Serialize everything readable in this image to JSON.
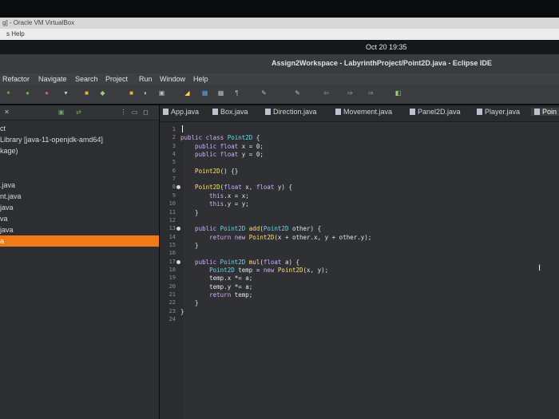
{
  "vbox": {
    "title": "g] - Oracle VM VirtualBox",
    "menu_help": "s    Help"
  },
  "topbar": {
    "clock": "Oct 20  19:35"
  },
  "window": {
    "title": "Assign2Workspace - LabyrinthProject/Point2D.java - Eclipse IDE"
  },
  "menubar": {
    "items": [
      "Refactor",
      "Navigate",
      "Search",
      "Project",
      "Run",
      "Window",
      "Help"
    ]
  },
  "explorer": {
    "items": [
      "ct",
      "Library [java-11-openjdk-amd64]",
      "kage)",
      ".java",
      "nt.java",
      "java",
      "va",
      "java",
      "a"
    ],
    "selected_index": 8
  },
  "tabs": [
    "App.java",
    "Box.java",
    "Direction.java",
    "Movement.java",
    "Panel2D.java",
    "Player.java",
    "Poin"
  ],
  "editor": {
    "lines": [
      {
        "n": "1",
        "fold": false,
        "tokens": []
      },
      {
        "n": "2",
        "fold": false,
        "tokens": [
          [
            "kw",
            "public class "
          ],
          [
            "ty",
            "Point2D"
          ],
          [
            "tx",
            " {"
          ]
        ]
      },
      {
        "n": "3",
        "fold": false,
        "tokens": [
          [
            "kw",
            "    public float "
          ],
          [
            "tx",
            "x = 0;"
          ]
        ]
      },
      {
        "n": "4",
        "fold": false,
        "tokens": [
          [
            "kw",
            "    public float "
          ],
          [
            "tx",
            "y = 0;"
          ]
        ]
      },
      {
        "n": "5",
        "fold": false,
        "tokens": []
      },
      {
        "n": "6",
        "fold": false,
        "tokens": [
          [
            "fn",
            "    Point2D"
          ],
          [
            "tx",
            "() {}"
          ]
        ]
      },
      {
        "n": "7",
        "fold": false,
        "tokens": []
      },
      {
        "n": "8",
        "fold": true,
        "tokens": [
          [
            "fn",
            "    Point2D"
          ],
          [
            "tx",
            "("
          ],
          [
            "kw",
            "float "
          ],
          [
            "tx",
            "x, "
          ],
          [
            "kw",
            "float "
          ],
          [
            "tx",
            "y) {"
          ]
        ]
      },
      {
        "n": "9",
        "fold": false,
        "tokens": [
          [
            "kw",
            "        this"
          ],
          [
            "tx",
            ".x = x;"
          ]
        ]
      },
      {
        "n": "10",
        "fold": false,
        "tokens": [
          [
            "kw",
            "        this"
          ],
          [
            "tx",
            ".y = y;"
          ]
        ]
      },
      {
        "n": "11",
        "fold": false,
        "tokens": [
          [
            "tx",
            "    }"
          ]
        ]
      },
      {
        "n": "12",
        "fold": false,
        "tokens": []
      },
      {
        "n": "13",
        "fold": true,
        "tokens": [
          [
            "kw",
            "    public "
          ],
          [
            "ty",
            "Point2D "
          ],
          [
            "fn",
            "add"
          ],
          [
            "tx",
            "("
          ],
          [
            "ty",
            "Point2D "
          ],
          [
            "tx",
            "other) {"
          ]
        ]
      },
      {
        "n": "14",
        "fold": false,
        "tokens": [
          [
            "kw",
            "        return new "
          ],
          [
            "fn",
            "Point2D"
          ],
          [
            "tx",
            "(x + other.x, y + other.y);"
          ]
        ]
      },
      {
        "n": "15",
        "fold": false,
        "tokens": [
          [
            "tx",
            "    }"
          ]
        ]
      },
      {
        "n": "16",
        "fold": false,
        "tokens": []
      },
      {
        "n": "17",
        "fold": true,
        "tokens": [
          [
            "kw",
            "    public "
          ],
          [
            "ty",
            "Point2D "
          ],
          [
            "fn",
            "mul"
          ],
          [
            "tx",
            "("
          ],
          [
            "kw",
            "float "
          ],
          [
            "tx",
            "a) {"
          ]
        ]
      },
      {
        "n": "18",
        "fold": false,
        "tokens": [
          [
            "ty",
            "        Point2D "
          ],
          [
            "tx",
            "temp = "
          ],
          [
            "kw",
            "new "
          ],
          [
            "fn",
            "Point2D"
          ],
          [
            "tx",
            "(x, y);"
          ]
        ]
      },
      {
        "n": "19",
        "fold": false,
        "tokens": [
          [
            "tx",
            "        temp.x *= a;"
          ]
        ]
      },
      {
        "n": "20",
        "fold": false,
        "tokens": [
          [
            "tx",
            "        temp.y *= a;"
          ]
        ]
      },
      {
        "n": "21",
        "fold": false,
        "tokens": [
          [
            "kw",
            "        return "
          ],
          [
            "tx",
            "temp;"
          ]
        ]
      },
      {
        "n": "22",
        "fold": false,
        "tokens": [
          [
            "tx",
            "    }"
          ]
        ]
      },
      {
        "n": "23",
        "fold": false,
        "tokens": [
          [
            "tx",
            "}"
          ]
        ]
      },
      {
        "n": "24",
        "fold": false,
        "tokens": []
      }
    ]
  }
}
